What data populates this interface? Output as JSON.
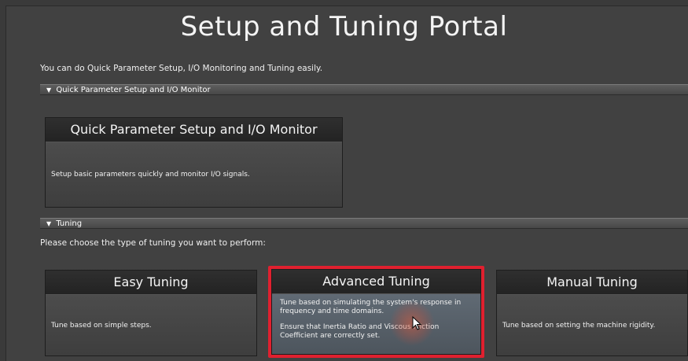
{
  "page": {
    "title": "Setup and Tuning Portal",
    "intro": "You can do Quick Parameter Setup, I/O Monitoring and Tuning easily."
  },
  "sections": {
    "quick": {
      "header": "Quick Parameter Setup and I/O Monitor",
      "card_title": "Quick Parameter Setup and I/O Monitor",
      "card_desc": "Setup basic parameters quickly and monitor I/O signals."
    },
    "tuning": {
      "header": "Tuning",
      "prompt": "Please choose the type of tuning you want to perform:",
      "cards": [
        {
          "title": "Easy Tuning",
          "desc": "Tune based on simple steps."
        },
        {
          "title": "Advanced Tuning",
          "desc": "Tune based on simulating the system's response in frequency and time domains.",
          "note": "Ensure that Inertia Ratio and Viscous Friction Coefficient are correctly set."
        },
        {
          "title": "Manual Tuning",
          "desc": "Tune based on setting the machine rigidity."
        }
      ]
    }
  },
  "colors": {
    "highlight": "#e0202f",
    "background": "#414141"
  },
  "icons": {
    "collapse": "triangle-down-icon",
    "pointer": "mouse-cursor-icon"
  }
}
